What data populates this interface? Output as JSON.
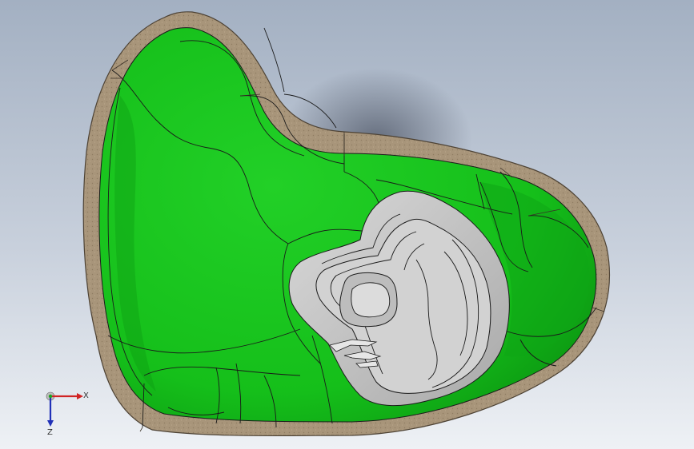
{
  "colors": {
    "background_top": "#a9b5c6",
    "background_bottom": "#edf0f4",
    "rim": "#a89477",
    "rim_dark": "#6f604c",
    "green": "#17c41c",
    "green_light": "#3ae23c",
    "green_dark": "#0a8e10",
    "gray_face": "#c9c9c9",
    "gray_dark": "#8d8d8d",
    "axis_x": "#d02424",
    "axis_y": "#1fa21f",
    "axis_z": "#2131b8"
  },
  "triad": {
    "x_label": "X",
    "z_label": "Z"
  }
}
